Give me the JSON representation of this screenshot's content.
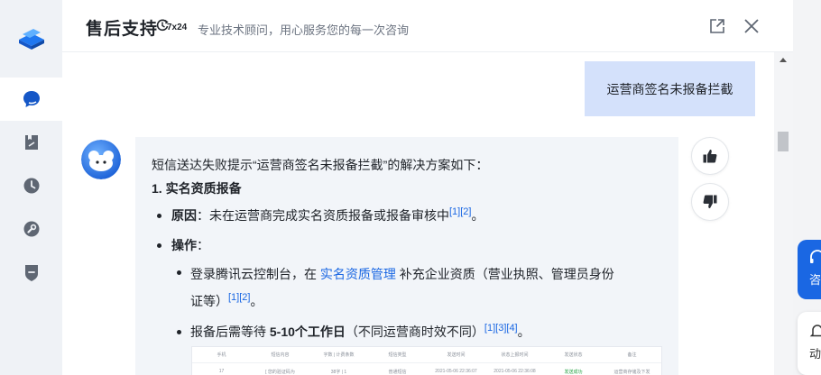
{
  "header": {
    "title": "售后支持",
    "badge_text": "7x24",
    "subtitle": "专业技术顾问，用心服务您的每一次咨询"
  },
  "sidebar": {
    "items": [
      {
        "icon": "logo-icon"
      },
      {
        "icon": "chat-icon",
        "active": true
      },
      {
        "icon": "document-icon"
      },
      {
        "icon": "clock-icon"
      },
      {
        "icon": "wrench-icon"
      },
      {
        "icon": "shield-icon"
      }
    ]
  },
  "conversation": {
    "user_message": "运营商签名未报备拦截",
    "answer": {
      "intro": "短信送达失败提示“运营商签名未报备拦截”的解决方案如下：",
      "heading": "1. 实名资质报备",
      "cause_label": "原因",
      "cause_text": "：未在运营商完成实名资质报备或报备审核中",
      "cause_refs": "[1][2]",
      "cause_end": "。",
      "action_label": "操作",
      "action_colon": "：",
      "step1_pre": "登录腾讯云控制台，在 ",
      "step1_link": "实名资质管理",
      "step1_post": " 补充企业资质（营业执照、管理员身份",
      "step1_cont": "证等）",
      "step1_refs": "[1][2]",
      "step1_end": "。",
      "step2_pre": "报备后需等待 ",
      "step2_bold": "5-10个工作日",
      "step2_post": "（不同运营商时效不同）",
      "step2_refs": "[1][3][4]",
      "step2_end": "。"
    },
    "table_preview": {
      "headers": [
        "手机",
        "短信内容",
        "字数 | 计费条数",
        "短信类型",
        "发送时间",
        "状态上报时间",
        "发送状态",
        "备注"
      ],
      "row": [
        "17",
        "[ 您的验证码为",
        "38字 | 1",
        "普通短信",
        "2021-05-06 22:36:07",
        "2021-05-06 22:36:08",
        "发送成功",
        "运营商存储及下发"
      ]
    }
  },
  "floating": {
    "consult_label": "咨",
    "dynamic_label": "动"
  },
  "colors": {
    "accent": "#1a67e3",
    "user_bubble": "#d4e1fb",
    "answer_bg": "#f2f5f9",
    "rail_bg": "#eff2f6"
  }
}
